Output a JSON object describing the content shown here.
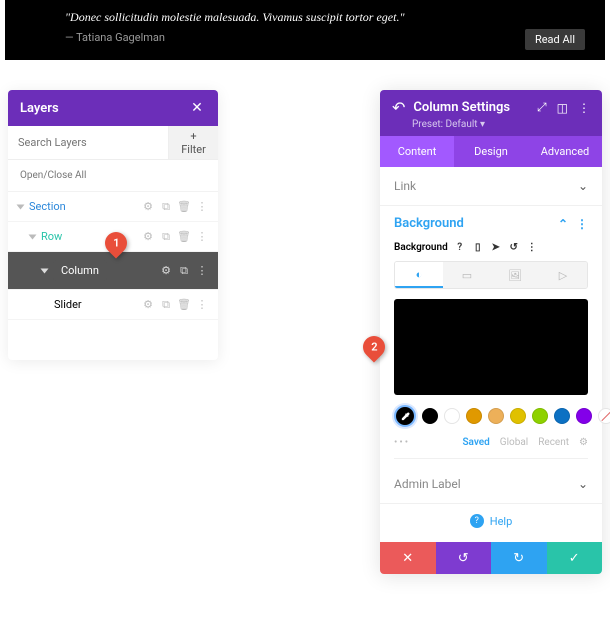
{
  "banner": {
    "quote": "\"Donec sollicitudin molestie malesuada. Vivamus suscipit tortor eget.\"",
    "author": "— Tatiana Gagelman",
    "read_all": "Read All"
  },
  "layers": {
    "title": "Layers",
    "search_placeholder": "Search Layers",
    "filter": "+ Filter",
    "open_close": "Open/Close All",
    "items": [
      {
        "label": "Section",
        "kind": "section"
      },
      {
        "label": "Row",
        "kind": "row"
      },
      {
        "label": "Column",
        "kind": "column"
      },
      {
        "label": "Slider",
        "kind": "module"
      }
    ]
  },
  "callouts": {
    "one": "1",
    "two": "2"
  },
  "settings": {
    "title": "Column Settings",
    "preset": "Preset: Default",
    "tabs": {
      "content": "Content",
      "design": "Design",
      "advanced": "Advanced"
    },
    "link": "Link",
    "background": {
      "title": "Background",
      "label": "Background",
      "preview_color": "#000000",
      "swatches": [
        "#000000",
        "#ffffff",
        "#e09900",
        "#edb059",
        "#e0c100",
        "#8ed100",
        "#0c71c3",
        "#8300e9"
      ],
      "saved": "Saved",
      "global": "Global",
      "recent": "Recent"
    },
    "admin_label": "Admin Label",
    "help": "Help"
  }
}
